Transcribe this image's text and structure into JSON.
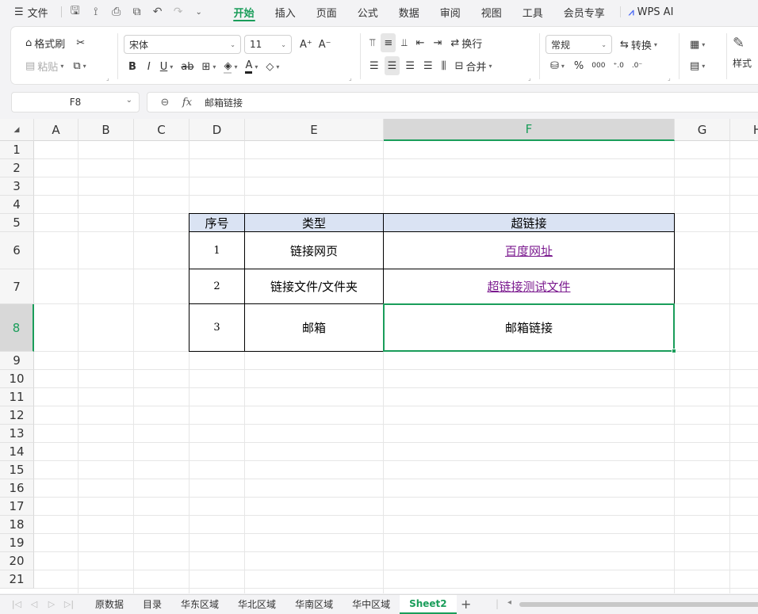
{
  "menu": {
    "file": "文件",
    "tabs": [
      "开始",
      "插入",
      "页面",
      "公式",
      "数据",
      "审阅",
      "视图",
      "工具",
      "会员专享"
    ],
    "active_tab": 0,
    "ai": "WPS AI"
  },
  "ribbon": {
    "format_painter": "格式刷",
    "paste": "粘贴",
    "font_name": "宋体",
    "font_size": "11",
    "bold": "B",
    "italic": "I",
    "underline": "U",
    "strike": "ab",
    "wrap": "换行",
    "merge": "合并",
    "number_format": "常规",
    "convert": "转换",
    "percent": "%",
    "styles": "样式"
  },
  "formula_bar": {
    "name_box": "F8",
    "fx": "fx",
    "value": "邮箱链接"
  },
  "grid": {
    "columns": [
      "A",
      "B",
      "C",
      "D",
      "E",
      "F",
      "G",
      "H"
    ],
    "rows": [
      "1",
      "2",
      "3",
      "4",
      "5",
      "6",
      "7",
      "8",
      "9",
      "10",
      "11",
      "12",
      "13",
      "14",
      "15",
      "16",
      "17",
      "18",
      "19",
      "20",
      "21"
    ],
    "selected_col": "F",
    "selected_row": "8"
  },
  "table": {
    "headers": [
      "序号",
      "类型",
      "超链接"
    ],
    "rows": [
      [
        "1",
        "链接网页",
        "百度网址"
      ],
      [
        "2",
        "链接文件/文件夹",
        "超链接测试文件"
      ],
      [
        "3",
        "邮箱",
        "邮箱链接"
      ]
    ]
  },
  "sheets": {
    "tabs": [
      "原数据",
      "目录",
      "华东区域",
      "华北区域",
      "华南区域",
      "华中区域",
      "Sheet2"
    ],
    "active": "Sheet2"
  },
  "colors": {
    "accent": "#1a9d5a",
    "header_fill": "#dae3f3",
    "link": "#7b1a8f"
  }
}
